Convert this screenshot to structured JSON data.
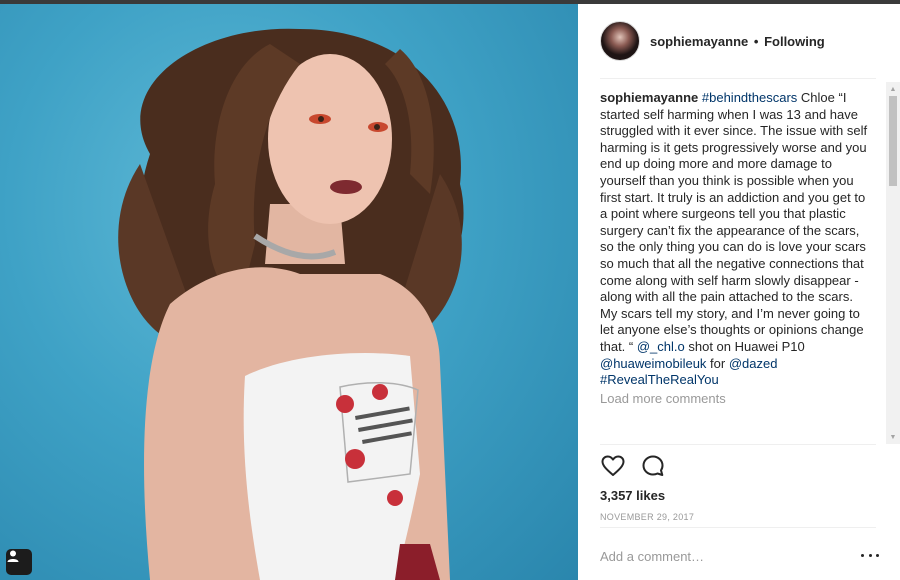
{
  "post": {
    "username": "sophiemayanne",
    "separator": "•",
    "follow_status": "Following"
  },
  "caption": {
    "username": "sophiemayanne",
    "hashtag": "#behindthescars",
    "body_part1": " Chloe “I started self harming when I was 13 and have struggled with it ever since. The issue with self harming is it gets progressively worse and you end up doing more and more damage to yourself than you think is possible when you first start. It truly is an addiction and you get to a point where surgeons tell you that plastic surgery can’t fix the appearance of the scars, so the only thing you can do is love your scars so much that all the negative connections that come along with self harm slowly disappear - along with all the pain attached to the scars.",
    "body_part2": "My scars tell my story, and I’m never going to let anyone else’s thoughts or opinions change that. “ ",
    "mention_photographer": "@_chl.o",
    "shot_on": " shot on Huawei P10 ",
    "mention_brand": "@huaweimobileuk",
    "for_text": " for ",
    "mention_pub": "@dazed",
    "hashtag2": "#RevealTheRealYou"
  },
  "comments": {
    "load_more_label": "Load more comments"
  },
  "actions": {
    "like_icon": "heart-outline-icon",
    "comment_icon": "speech-bubble-icon"
  },
  "stats": {
    "likes": "3,357 likes",
    "date": "NOVEMBER 29, 2017"
  },
  "add_comment": {
    "placeholder": "Add a comment…",
    "more_icon": "ellipsis-icon"
  },
  "colors": {
    "link": "#003569",
    "muted": "#999999",
    "photo_bg": "#3fa2c6"
  }
}
